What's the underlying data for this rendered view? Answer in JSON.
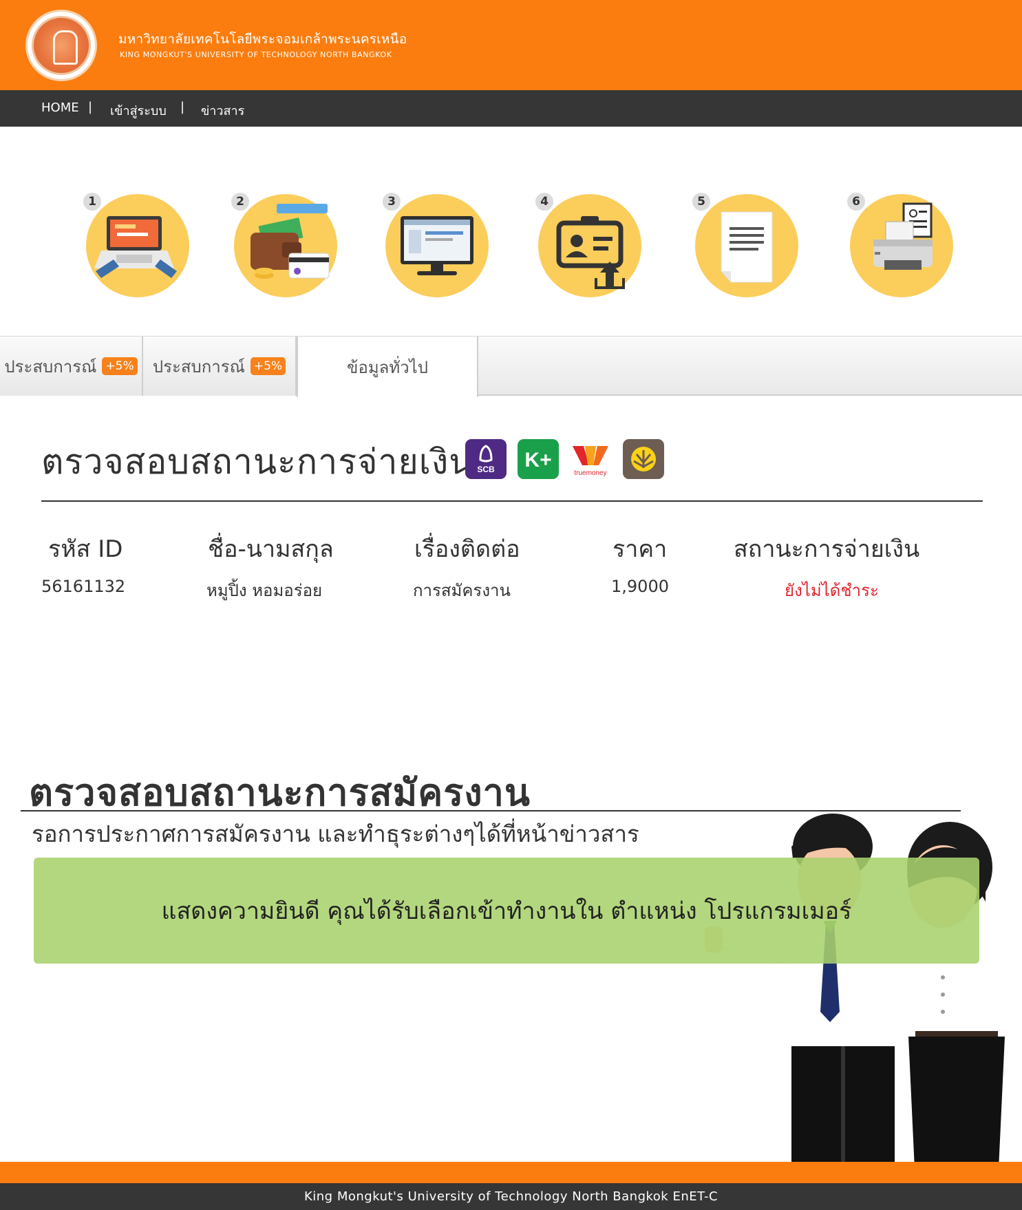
{
  "header": {
    "university_th": "มหาวิทยาลัยเทคโนโลยีพระจอมเกล้าพระนครเหนือ",
    "university_en": "KING MONGKUT'S UNIVERSITY OF TECHNOLOGY NORTH BANGKOK",
    "logo_icon": "university-seal-icon"
  },
  "nav": {
    "home": "HOME",
    "sep": "|",
    "login": "เข้าสู่ระบบ",
    "news": "ข่าวสาร"
  },
  "steps": [
    {
      "number": "1",
      "icon": "laptop-typing-icon"
    },
    {
      "number": "2",
      "icon": "wallet-payment-icon"
    },
    {
      "number": "3",
      "icon": "monitor-icon"
    },
    {
      "number": "4",
      "icon": "id-card-upload-icon"
    },
    {
      "number": "5",
      "icon": "document-icon"
    },
    {
      "number": "6",
      "icon": "printer-icon"
    }
  ],
  "tabs": [
    {
      "label": "ประสบการณ์",
      "badge": "+5%"
    },
    {
      "label": "ประสบการณ์",
      "badge": "+5%"
    },
    {
      "label": "ข้อมูลทั่วไป",
      "active": true
    }
  ],
  "payment": {
    "title": "ตรวจสอบสถานะการจ่ายเงิน",
    "methods": [
      {
        "name": "SCB",
        "icon": "scb-icon",
        "color": "#4e2a84"
      },
      {
        "name": "K+",
        "icon": "kplus-icon",
        "color": "#1aa04a"
      },
      {
        "name": "truemoney",
        "icon": "truemoney-icon",
        "color": "#f26a1b"
      },
      {
        "name": "Krungsri",
        "icon": "krungsri-icon",
        "color": "#6d5d53"
      }
    ],
    "headers": {
      "id": "รหัส ID",
      "name": "ชื่อ-นามสกุล",
      "subject": "เรื่องติดต่อ",
      "price": "ราคา",
      "status": "สถานะการจ่ายเงิน"
    },
    "row": {
      "id": "56161132",
      "name": "หมูปิ้ง  หอมอร่อย",
      "subject": "การสมัครงาน",
      "price": "1,9000",
      "status": "ยังไม่ได้ชำระ"
    },
    "status_color": "#e0252f"
  },
  "application": {
    "title": "ตรวจสอบสถานะการสมัครงาน",
    "subtitle": "รอการประกาศการสมัครงาน และทำธุระต่างๆได้ที่หน้าข่าวสาร",
    "result": "แสดงความยินดี คุณได้รับเลือกเข้าทำงานใน ตำแหน่ง โปรแกรมเมอร์"
  },
  "footer": {
    "text": "King Mongkut's University of Technology North Bangkok EnET-C"
  },
  "colors": {
    "brand_orange": "#fb7d0f",
    "nav_dark": "#363636",
    "step_yellow": "#fbcd5b",
    "success_green": "#a8d26c"
  }
}
